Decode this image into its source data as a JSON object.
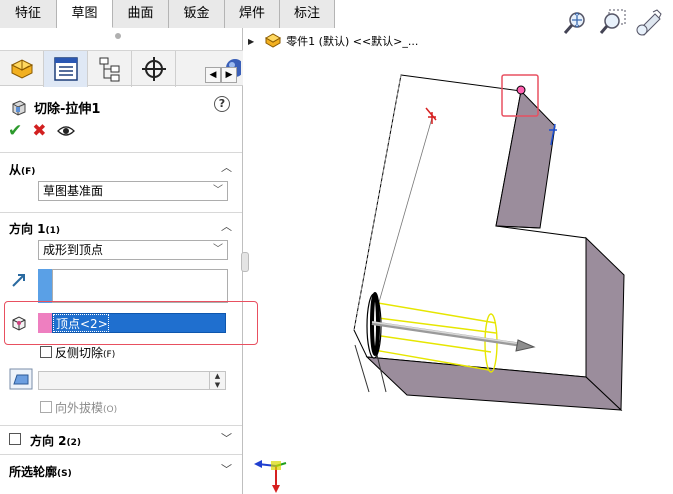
{
  "tabs": [
    "特征",
    "草图",
    "曲面",
    "钣金",
    "焊件",
    "标注"
  ],
  "active_tab_index": 1,
  "feature": {
    "title": "切除-拉伸1",
    "help_label": "?"
  },
  "from_section": {
    "header": "从",
    "shortcut": "(F)",
    "value": "草图基准面"
  },
  "direction1": {
    "header": "方向 1",
    "shortcut": "(1)",
    "end_condition": "成形到顶点",
    "vertex_value": "顶点<2>",
    "flip_label": "反侧切除",
    "flip_shortcut": "(F)",
    "draft_outward_label": "向外拔模",
    "draft_outward_shortcut": "(O)"
  },
  "direction2": {
    "header": "方向 2",
    "shortcut": "(2)"
  },
  "selected_contours": {
    "header": "所选轮廓",
    "shortcut": "(S)"
  },
  "tree": {
    "label": "零件1 (默认) <<默认>_..."
  },
  "icons": {
    "feature_icon": "cut-extrude-icon",
    "ok": "check-icon",
    "cancel": "close-icon",
    "preview": "eye-icon"
  },
  "colors": {
    "highlight_frame": "#e85060",
    "selection_blue": "#1f6fcf",
    "direction_bar": "#5aa0e6",
    "vertex_bar": "#ee7fc0"
  }
}
